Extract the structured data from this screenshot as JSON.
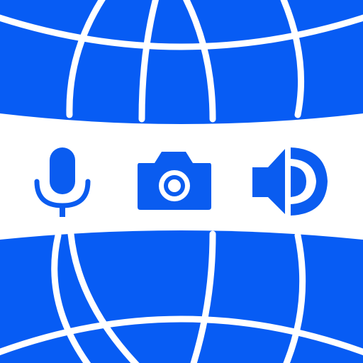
{
  "icon": {
    "kind": "app-icon",
    "motif": "globe",
    "center_glyphs": [
      "microphone-icon",
      "camera-icon",
      "speaker-icon"
    ]
  },
  "colors": {
    "globe_blue": "#075cf4",
    "grid_line": "#ffffff",
    "band": "#ffffff",
    "glyph_blue": "#0a5cf0"
  }
}
